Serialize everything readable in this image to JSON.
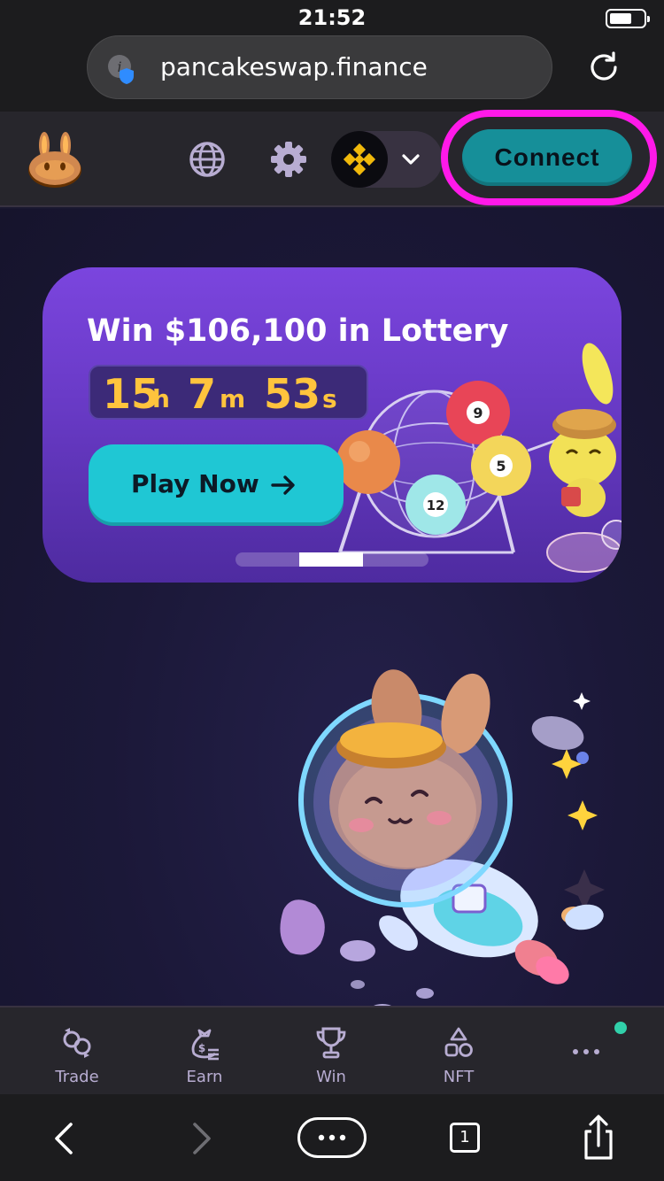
{
  "status_bar": {
    "time": "21:52"
  },
  "browser": {
    "url": "pancakeswap.finance",
    "tab_count": "1"
  },
  "header": {
    "connect_label": "Connect"
  },
  "banner": {
    "title": "Win $106,100 in Lottery",
    "countdown": {
      "hours": "15",
      "hours_unit": "h",
      "minutes": "7",
      "minutes_unit": "m",
      "seconds": "53",
      "seconds_unit": "s"
    },
    "play_label": "Play Now",
    "ball_numbers": [
      "9",
      "5",
      "12"
    ],
    "pager": {
      "count": 3,
      "active_index": 1
    }
  },
  "bottom_nav": {
    "items": [
      {
        "label": "Trade",
        "icon": "trade-icon"
      },
      {
        "label": "Earn",
        "icon": "earn-icon"
      },
      {
        "label": "Win",
        "icon": "trophy-icon"
      },
      {
        "label": "NFT",
        "icon": "nft-icon"
      }
    ]
  },
  "colors": {
    "primary": "#1fc7d4",
    "highlight": "#ff19e9",
    "countdown": "#ffc43d",
    "header_bg": "#27262c"
  }
}
